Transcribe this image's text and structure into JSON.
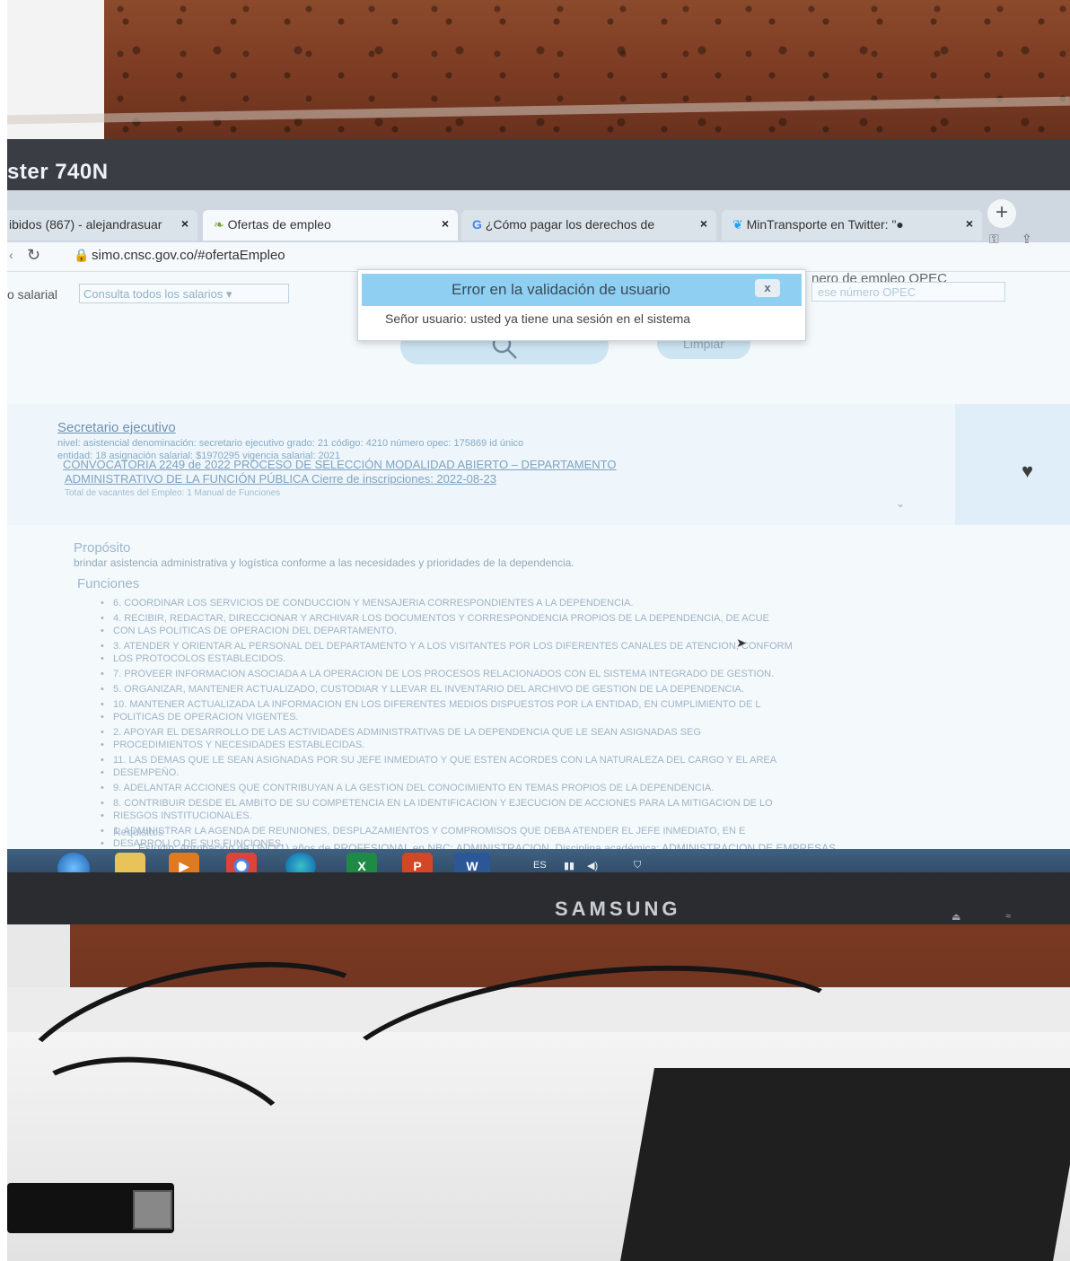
{
  "monitor": {
    "model_label": "ster 740N",
    "brand": "SAMSUNG"
  },
  "browser": {
    "tabs": [
      {
        "label": "ibidos (867) - alejandrasuar",
        "close": "×"
      },
      {
        "label": "Ofertas de empleo",
        "close": "×"
      },
      {
        "label": "¿Cómo pagar los derechos de",
        "close": "×"
      },
      {
        "label": "MinTransporte en Twitter: \"●",
        "close": "×"
      }
    ],
    "new_tab": "+",
    "url": "simo.cnsc.gov.co/#ofertaEmpleo"
  },
  "filters": {
    "salary_label": "o salarial",
    "salary_select_value": "Consulta todos los salarios",
    "opec_label": "nero de empleo OPEC",
    "opec_placeholder": "ese número OPEC"
  },
  "buttons": {
    "search_icon": "search-icon",
    "clear_label": "Limpiar"
  },
  "modal": {
    "title": "Error en la validación de usuario",
    "close": "x",
    "message": "Señor usuario: usted ya tiene una sesión en el sistema"
  },
  "job": {
    "title": "Secretario ejecutivo",
    "meta1": "nivel: asistencial   denominación: secretario ejecutivo   grado: 21   código: 4210   número opec: 175869   id único",
    "meta2": "entidad: 18   asignación salarial: $1970295   vigencia salarial: 2021",
    "convocatoria1": "CONVOCATORIA 2249 de 2022 PROCESO DE SELECCIÓN MODALIDAD ABIERTO – DEPARTAMENTO",
    "convocatoria2": "ADMINISTRATIVO DE LA FUNCIÓN PÚBLICA   Cierre de inscripciones: 2022-08-23",
    "links": "Total de vacantes del Empleo: 1   Manual de Funciones"
  },
  "sections": {
    "proposito_heading": "Propósito",
    "proposito_text": "brindar asistencia administrativa y logística conforme a las necesidades y prioridades de la dependencia.",
    "funciones_heading": "Funciones",
    "requisitos_heading": "Requisitos",
    "estudio": "Estudio: Aprobación de UNO(1) años de PROFESIONAL en NBC: ADMINISTRACION, Disciplina académica: ADMINISTRACION DE EMPRESAS"
  },
  "funciones": [
    "6. COORDINAR LOS SERVICIOS DE CONDUCCION Y MENSAJERIA CORRESPONDIENTES A LA DEPENDENCIA.",
    "4. RECIBIR, REDACTAR, DIRECCIONAR Y ARCHIVAR LOS DOCUMENTOS Y CORRESPONDENCIA PROPIOS DE LA DEPENDENCIA, DE ACUE",
    "CON LAS POLITICAS DE OPERACION DEL DEPARTAMENTO.",
    "3. ATENDER Y ORIENTAR AL PERSONAL DEL DEPARTAMENTO Y A LOS VISITANTES POR LOS DIFERENTES CANALES DE ATENCION, CONFORM",
    "LOS PROTOCOLOS ESTABLECIDOS.",
    "7. PROVEER INFORMACION ASOCIADA A LA OPERACION DE LOS PROCESOS RELACIONADOS CON EL SISTEMA INTEGRADO DE GESTION.",
    "5. ORGANIZAR, MANTENER ACTUALIZADO, CUSTODIAR Y LLEVAR EL INVENTARIO DEL ARCHIVO DE GESTION DE LA DEPENDENCIA.",
    "10. MANTENER ACTUALIZADA LA INFORMACION EN LOS DIFERENTES MEDIOS DISPUESTOS POR LA ENTIDAD, EN CUMPLIMIENTO DE L",
    "POLITICAS DE OPERACION VIGENTES.",
    "2. APOYAR EL DESARROLLO DE LAS ACTIVIDADES ADMINISTRATIVAS DE LA DEPENDENCIA QUE LE SEAN ASIGNADAS SEG",
    "PROCEDIMIENTOS Y NECESIDADES ESTABLECIDAS.",
    "11. LAS DEMAS QUE LE SEAN ASIGNADAS POR SU JEFE INMEDIATO Y QUE ESTEN ACORDES CON LA NATURALEZA DEL CARGO Y EL AREA",
    "DESEMPEÑO.",
    "9. ADELANTAR ACCIONES QUE CONTRIBUYAN A LA GESTION DEL CONOCIMIENTO EN TEMAS PROPIOS DE LA DEPENDENCIA.",
    "8. CONTRIBUIR DESDE EL AMBITO DE SU COMPETENCIA EN LA IDENTIFICACION Y EJECUCION DE ACCIONES PARA LA MITIGACION DE LO",
    "RIESGOS INSTITUCIONALES.",
    "1. ADMINISTRAR LA AGENDA DE REUNIONES, DESPLAZAMIENTOS Y COMPROMISOS QUE DEBA ATENDER EL JEFE INMEDIATO, EN E",
    "DESARROLLO DE SUS FUNCIONES."
  ],
  "taskbar": {
    "items": [
      "start-orb",
      "file-explorer",
      "media-player",
      "chrome",
      "edge",
      "excel",
      "powerpoint",
      "word"
    ],
    "excel_letter": "X",
    "ppt_letter": "P",
    "word_letter": "W",
    "lang": "ES"
  }
}
